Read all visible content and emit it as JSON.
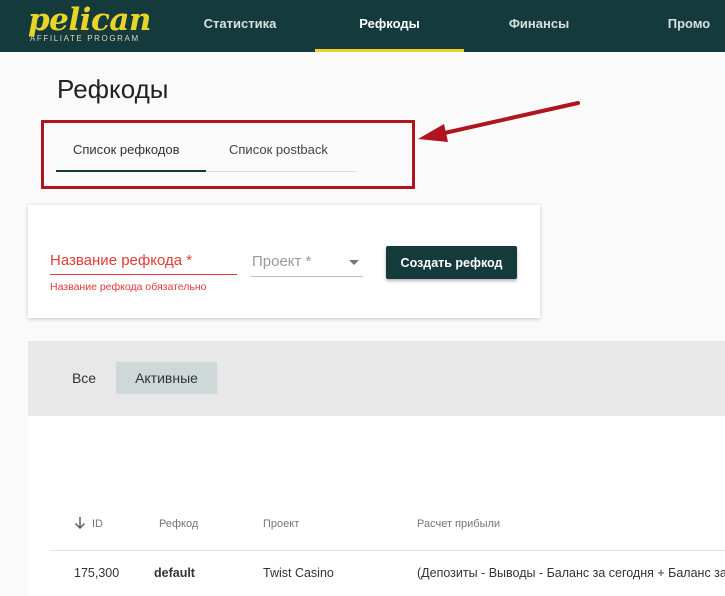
{
  "brand": {
    "name": "pelican",
    "tagline": "AFFILIATE PROGRAM",
    "accent_color": "#e9d52a",
    "header_color": "#143a3b"
  },
  "nav": {
    "items": [
      {
        "label": "Статистика"
      },
      {
        "label": "Рефкоды",
        "active": true
      },
      {
        "label": "Финансы"
      },
      {
        "label": "Промо"
      }
    ]
  },
  "page": {
    "title": "Рефкоды"
  },
  "tabs": [
    {
      "label": "Список рефкодов",
      "active": true
    },
    {
      "label": "Список postback"
    }
  ],
  "form": {
    "name_label": "Название рефкода *",
    "name_error": "Название рефкода обязательно",
    "project_label": "Проект *",
    "create_button": "Создать рефкод"
  },
  "filters": {
    "all": "Все",
    "active": "Активные",
    "selected": "Активные"
  },
  "table": {
    "columns": [
      "ID",
      "Рефкод",
      "Проект",
      "Расчет прибыли"
    ],
    "rows": [
      {
        "id": "175,300",
        "refcode": "default",
        "project": "Twist Casino",
        "formula": "(Депозиты - Выводы - Баланс за сегодня + Баланс за в"
      }
    ]
  }
}
